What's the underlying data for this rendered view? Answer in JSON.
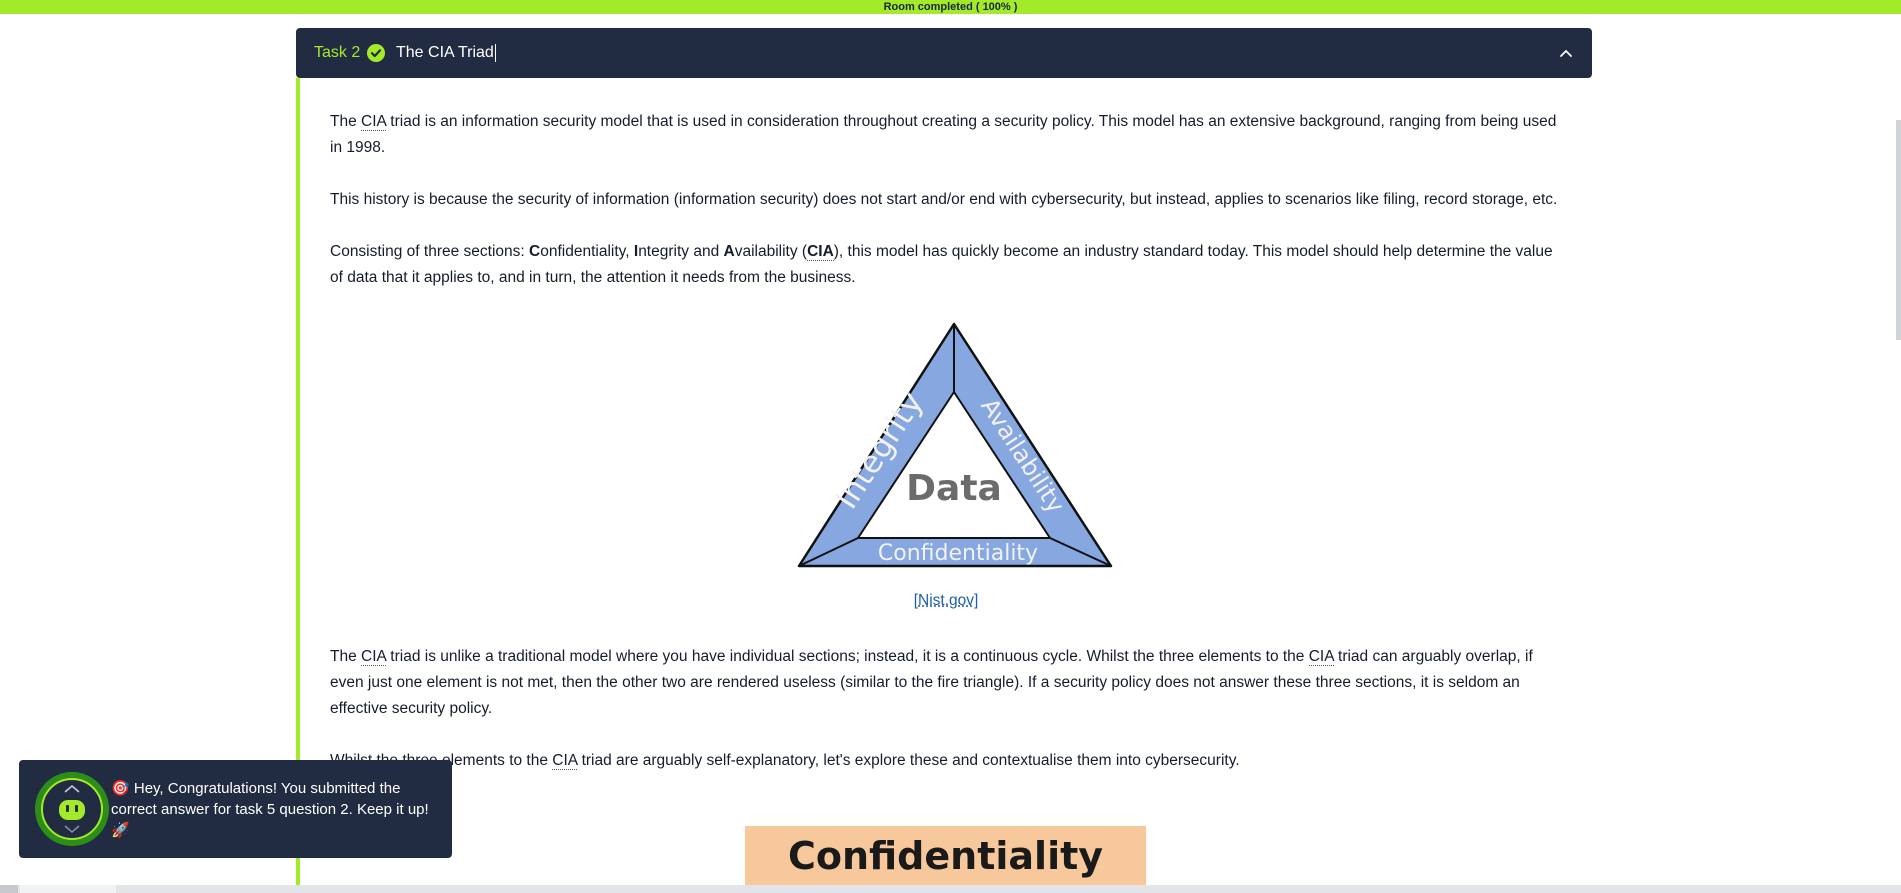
{
  "progress": {
    "label": "Room completed ( 100% )",
    "percent": 100
  },
  "task": {
    "label": "Task 2",
    "title": "The CIA Triad",
    "completed": true
  },
  "content": {
    "p1_pre": "The ",
    "p1_abbr": "CIA",
    "p1_post": " triad is an information security model that is used in consideration throughout creating a security policy. This model has an extensive background, ranging from being used in 1998.",
    "p2": "This history is because the security of information (information security) does not start and/or end with cybersecurity, but instead, applies to scenarios like filing, record storage, etc.",
    "p3": {
      "pre": "Consisting of three sections: ",
      "c_bold": "C",
      "c_rest": "onfidentiality, ",
      "i_bold": "I",
      "i_rest": "ntegrity and ",
      "a_bold": "A",
      "a_rest": "vailability (",
      "abbr": "CIA",
      "post": "), this model has quickly become an industry standard today. This model should help determine the value of data that it applies to, and in turn, the attention it needs from the business."
    },
    "figure": {
      "center_label": "Data",
      "left_label": "Integrity",
      "right_label": "Availability",
      "bottom_label": "Confidentiality",
      "source_open": "[",
      "source_link": "Nist.gov",
      "source_close": "]"
    },
    "p4": {
      "a": "The ",
      "abbr1": "CIA",
      "b": " triad is unlike a traditional model where you have individual sections; instead, it is a continuous cycle. Whilst the three elements to the ",
      "abbr2": "CIA",
      "c": " triad can arguably overlap, if even just one element is not met, then the other two are rendered useless (similar to the fire triangle). If a security policy does not answer these three sections, it is seldom an effective security policy."
    },
    "p5": {
      "a": "Whilst the three elements to the ",
      "abbr": "CIA",
      "b": " triad are arguably self-explanatory, let's explore these and contextualise them into cybersecurity."
    },
    "section_banner": "Confidentiality"
  },
  "toast": {
    "icon_emoji": "🎯",
    "message": "Hey, Congratulations! You submitted the correct answer for task 5 question 2. Keep it up!",
    "end_emoji": "🚀"
  },
  "colors": {
    "accent": "#a3ea2a",
    "header_bg": "#212c42",
    "triangle_fill": "#87a7e0",
    "banner_bg": "#f7c89b",
    "link": "#1c5fb0"
  }
}
